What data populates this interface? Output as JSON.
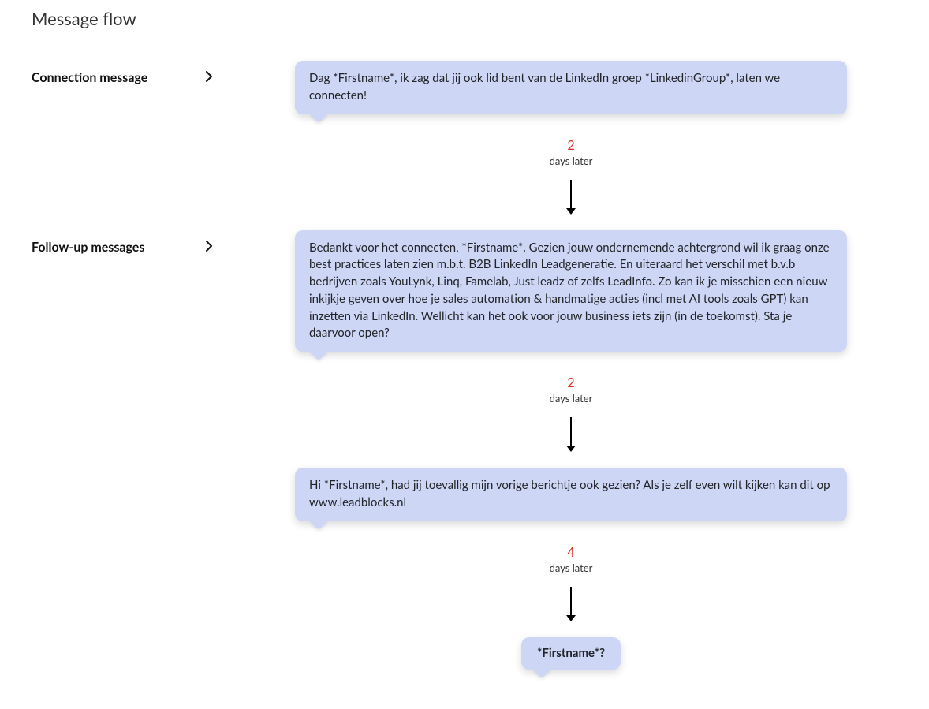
{
  "title": "Message flow",
  "labels": {
    "connection": "Connection message",
    "followup": "Follow-up  messages",
    "days_later": "days later"
  },
  "steps": [
    {
      "text": "Dag *Firstname*, ik zag dat jij ook lid bent van de LinkedIn groep *LinkedinGroup*, laten we connecten!",
      "delay_after": 2
    },
    {
      "text": "Bedankt voor het connecten, *Firstname*. Gezien jouw ondernemende achtergrond wil ik graag onze best practices laten zien m.b.t. B2B LinkedIn Leadgeneratie. En uiteraard het verschil met b.v.b bedrijven zoals YouLynk, Linq, Famelab, Just leadz of zelfs LeadInfo. Zo kan ik je misschien een nieuw inkijkje geven over hoe je sales automation & handmatige acties (incl met AI tools zoals GPT) kan inzetten via LinkedIn. Wellicht kan het ook voor jouw business iets zijn (in de toekomst). Sta je daarvoor open?",
      "delay_after": 2
    },
    {
      "text": "Hi *Firstname*, had jij toevallig mijn vorige berichtje ook gezien? Als je zelf even wilt kijken kan dit op www.leadblocks.nl",
      "delay_after": 4
    },
    {
      "text": "*Firstname*?",
      "small": true
    }
  ]
}
